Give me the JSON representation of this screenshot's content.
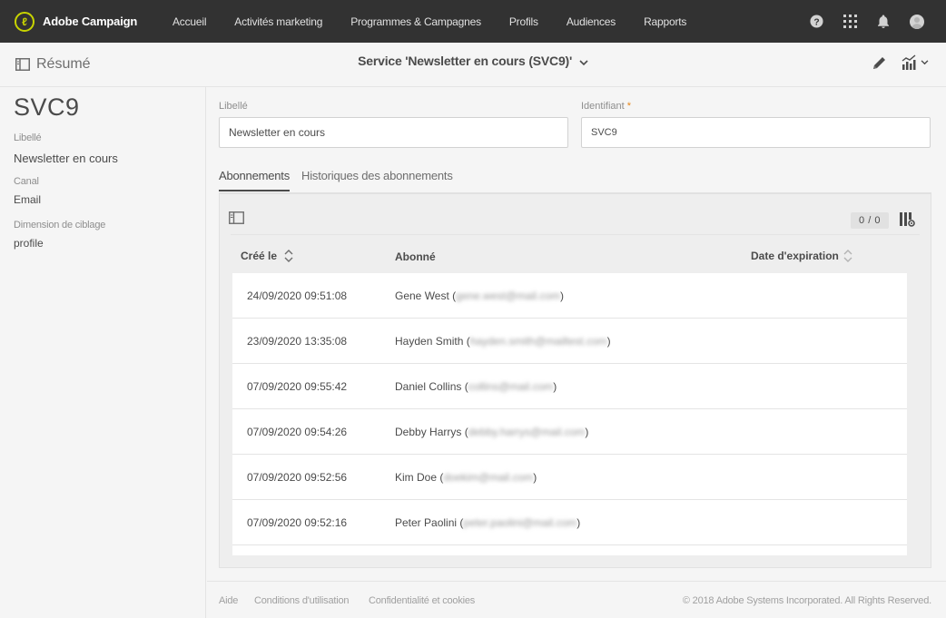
{
  "app": {
    "brand_name": "Adobe Campaign",
    "brand_logo_glyph": "ℓ",
    "accent_color": "#c8d400"
  },
  "nav": {
    "items": [
      {
        "label": "Accueil"
      },
      {
        "label": "Activités marketing"
      },
      {
        "label": "Programmes & Campagnes"
      },
      {
        "label": "Profils"
      },
      {
        "label": "Audiences"
      },
      {
        "label": "Rapports"
      }
    ],
    "icons": [
      "help-icon",
      "apps-grid-icon",
      "bell-icon",
      "avatar"
    ]
  },
  "subheader": {
    "summary_label": "Résumé",
    "title": "Service 'Newsletter en cours (SVC9)'"
  },
  "left": {
    "code": "SVC9",
    "fields": [
      {
        "label": "Libellé",
        "value": "Newsletter en cours"
      },
      {
        "label": "Canal",
        "value": "Email"
      },
      {
        "label": "Dimension de ciblage",
        "value": "profile"
      }
    ]
  },
  "form": {
    "label_field": {
      "label": "Libellé",
      "value": "Newsletter en cours"
    },
    "id_field": {
      "label": "Identifiant",
      "required_mark": "*",
      "value": "SVC9"
    }
  },
  "tabs": [
    {
      "label": "Abonnements",
      "active": true
    },
    {
      "label": "Historiques des abonnements",
      "active": false
    }
  ],
  "list": {
    "count": "0 / 0",
    "columns": {
      "created": "Créé le",
      "subscriber": "Abonné",
      "expiration": "Date d'expiration"
    },
    "rows": [
      {
        "date": "24/09/2020 09:51:08",
        "name": "Gene West",
        "email": "gene.west@mail.com"
      },
      {
        "date": "23/09/2020 13:35:08",
        "name": "Hayden Smith",
        "email": "hayden.smith@mailtest.com"
      },
      {
        "date": "07/09/2020 09:55:42",
        "name": "Daniel Collins",
        "email": "collins@mail.com"
      },
      {
        "date": "07/09/2020 09:54:26",
        "name": "Debby Harrys",
        "email": "debby.harrys@mail.com"
      },
      {
        "date": "07/09/2020 09:52:56",
        "name": "Kim Doe",
        "email": "doekim@mail.com"
      },
      {
        "date": "07/09/2020 09:52:16",
        "name": "Peter Paolini",
        "email": "peter.paolini@mail.com"
      }
    ]
  },
  "footer": {
    "links": [
      {
        "label": "Aide"
      },
      {
        "label": "Conditions d'utilisation"
      },
      {
        "label": "Confidentialité et cookies"
      }
    ],
    "copyright": "© 2018 Adobe Systems Incorporated. All Rights Reserved."
  }
}
